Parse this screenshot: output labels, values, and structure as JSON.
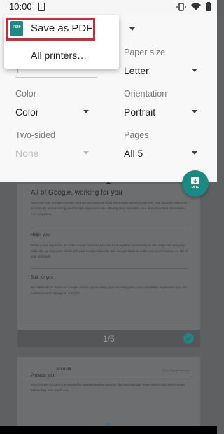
{
  "status": {
    "time": "10:00"
  },
  "printer_menu": {
    "selected": "Save as PDF",
    "icon_label": "PDF",
    "other": "All printers…"
  },
  "settings": {
    "copies_value": "1",
    "paper_size": {
      "label": "Paper size",
      "value": "Letter"
    },
    "color": {
      "label": "Color",
      "value": "Color"
    },
    "orientation": {
      "label": "Orientation",
      "value": "Portrait"
    },
    "two_sided": {
      "label": "Two-sided",
      "value": "None"
    },
    "pages": {
      "label": "Pages",
      "value": "All 5"
    }
  },
  "fab": {
    "label": "PDF"
  },
  "preview": {
    "page1": {
      "title": "All of Google, working for you",
      "intro": "Sign in to your Google Account, and get the most out of all the Google services you use. Your account helps you do more by personalizing your Google experience and offering easy access to your most important information from anywhere.",
      "section1_head": "Helps you",
      "section1_body": "When you're signed in, all of the Google services you use work together seamlessly to offer help with everyday tasks like syncing your Gmail with your Google Calendar and Google Maps to make sure you're always on top of your schedule.",
      "section2_head": "Built for you",
      "section2_body": "No matter which device or Google service you're using, your account gives you a consistent experience you can customize and manage at any time.",
      "page_number": "1/5"
    },
    "page2": {
      "header_left": "Account",
      "header_right": "Go to Google Account",
      "section_head": "Protects you",
      "body": "Your Google Account is protected by industry-leading security that automatically helps detect and block threats before they ever reach you."
    }
  },
  "colors": {
    "accent": "#1a8a85",
    "highlight": "#d02a35"
  }
}
